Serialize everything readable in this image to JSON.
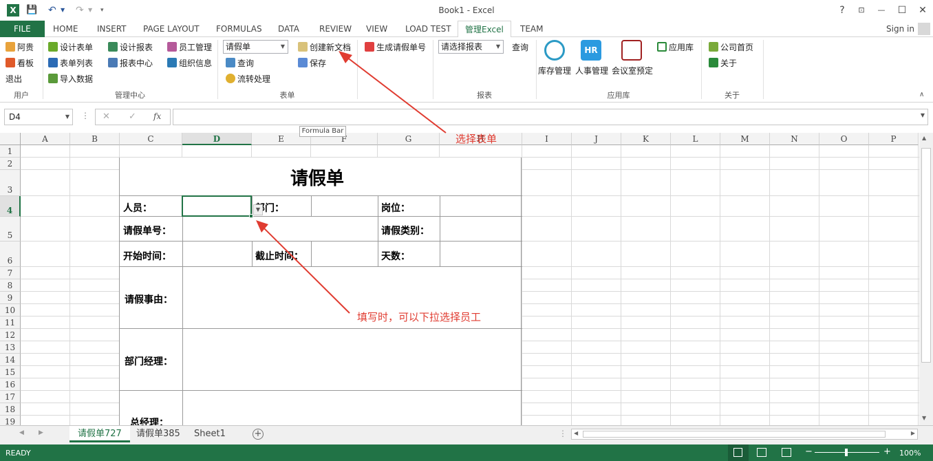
{
  "window": {
    "title": "Book1 - Excel",
    "help": "?",
    "minimize": "—",
    "maximize": "☐",
    "close": "✕"
  },
  "quick_access": {
    "save": "💾",
    "undo": "↶",
    "redo": "↷"
  },
  "tabs": [
    "FILE",
    "HOME",
    "INSERT",
    "PAGE LAYOUT",
    "FORMULAS",
    "DATA",
    "REVIEW",
    "VIEW",
    "LOAD TEST",
    "管理Excel",
    "TEAM"
  ],
  "signin": "Sign in",
  "ribbon": {
    "user": {
      "items": [
        "阿贵",
        "看板",
        "退出"
      ],
      "group": "用户"
    },
    "manage": {
      "items": [
        "设计表单",
        "表单列表",
        "导入数据",
        "设计报表",
        "报表中心",
        "员工管理",
        "组织信息"
      ],
      "group": "管理中心"
    },
    "form": {
      "select": "请假单",
      "query": "查询",
      "flow": "流转处理",
      "create": "创建新文档",
      "save": "保存",
      "group": "表单"
    },
    "generate": "生成请假单号",
    "report": {
      "select": "请选择报表",
      "query": "查询",
      "group": "报表"
    },
    "apps": {
      "items": [
        "库存管理",
        "人事管理",
        "会议室预定",
        "应用库"
      ],
      "group": "应用库"
    },
    "about": {
      "items": [
        "公司首页",
        "关于"
      ],
      "group": "关于"
    }
  },
  "formula_bar": {
    "namebox": "D4",
    "cancel": "✕",
    "enter": "✓",
    "fx": "fx",
    "tooltip": "Formula Bar"
  },
  "columns": [
    "A",
    "B",
    "C",
    "D",
    "E",
    "F",
    "G",
    "H",
    "I",
    "J",
    "K",
    "L",
    "M",
    "N",
    "O",
    "P"
  ],
  "rows": [
    "1",
    "2",
    "3",
    "4",
    "5",
    "6",
    "7",
    "8",
    "9",
    "10",
    "11",
    "12",
    "13",
    "14",
    "15",
    "16",
    "17",
    "18",
    "19"
  ],
  "sheet": {
    "title": "请假单",
    "labels": {
      "person": "人员：",
      "dept": "部门：",
      "post": "岗位：",
      "number": "请假单号：",
      "type": "请假类别：",
      "start": "开始时间：",
      "end": "截止时间：",
      "days": "天数：",
      "reason": "请假事由：",
      "manager": "部门经理：",
      "gm": "总经理："
    }
  },
  "annotations": {
    "choose_form": "选择表单",
    "dropdown_hint": "填写时，可以下拉选择员工"
  },
  "sheet_tabs": [
    "请假单727",
    "请假单385",
    "Sheet1"
  ],
  "status": {
    "ready": "READY",
    "zoom": "100%"
  },
  "colors": {
    "accent": "#217346",
    "annotation": "#e03c31"
  }
}
